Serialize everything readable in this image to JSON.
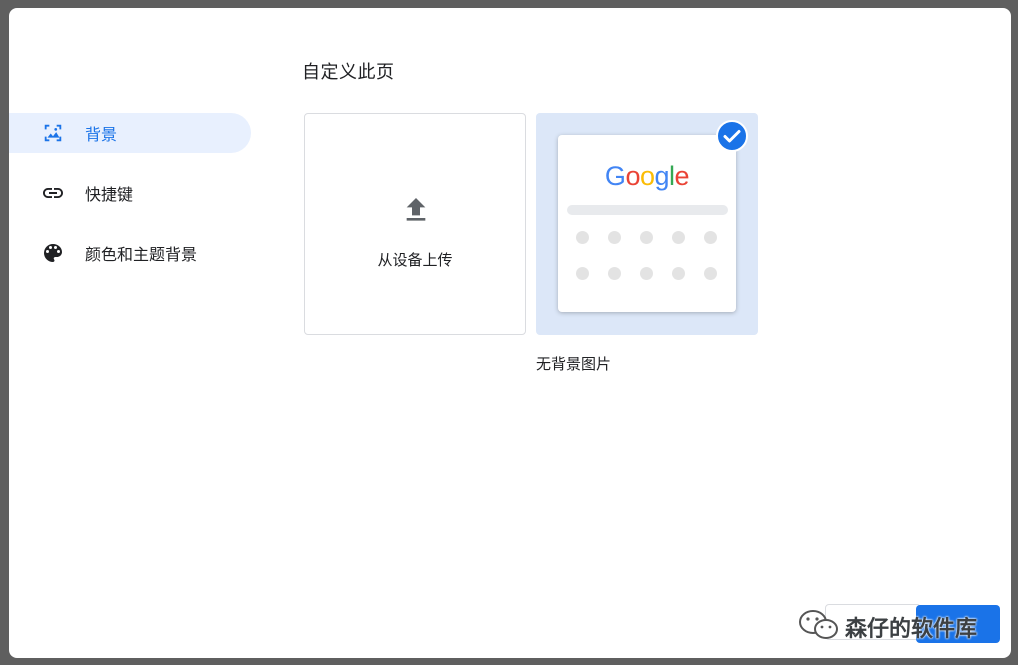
{
  "page": {
    "title": "自定义此页"
  },
  "sidebar": {
    "items": [
      {
        "label": "背景",
        "icon": "wallpaper-icon",
        "active": true
      },
      {
        "label": "快捷键",
        "icon": "link-icon",
        "active": false
      },
      {
        "label": "颜色和主题背景",
        "icon": "palette-icon",
        "active": false
      }
    ]
  },
  "backgrounds": {
    "upload_label": "从设备上传",
    "upload_icon": "upload-icon",
    "no_background_label": "无背景图片",
    "selected_icon": "check-circle-icon",
    "preview_logo": "Google"
  },
  "watermark": {
    "text": "森仔的软件库",
    "icon": "wechat-icon"
  },
  "colors": {
    "accent": "#1a73e8",
    "active_nav_bg": "#e8f0fe",
    "selected_tile_bg": "#dce7f8",
    "overlay": "#5f5f5f"
  }
}
